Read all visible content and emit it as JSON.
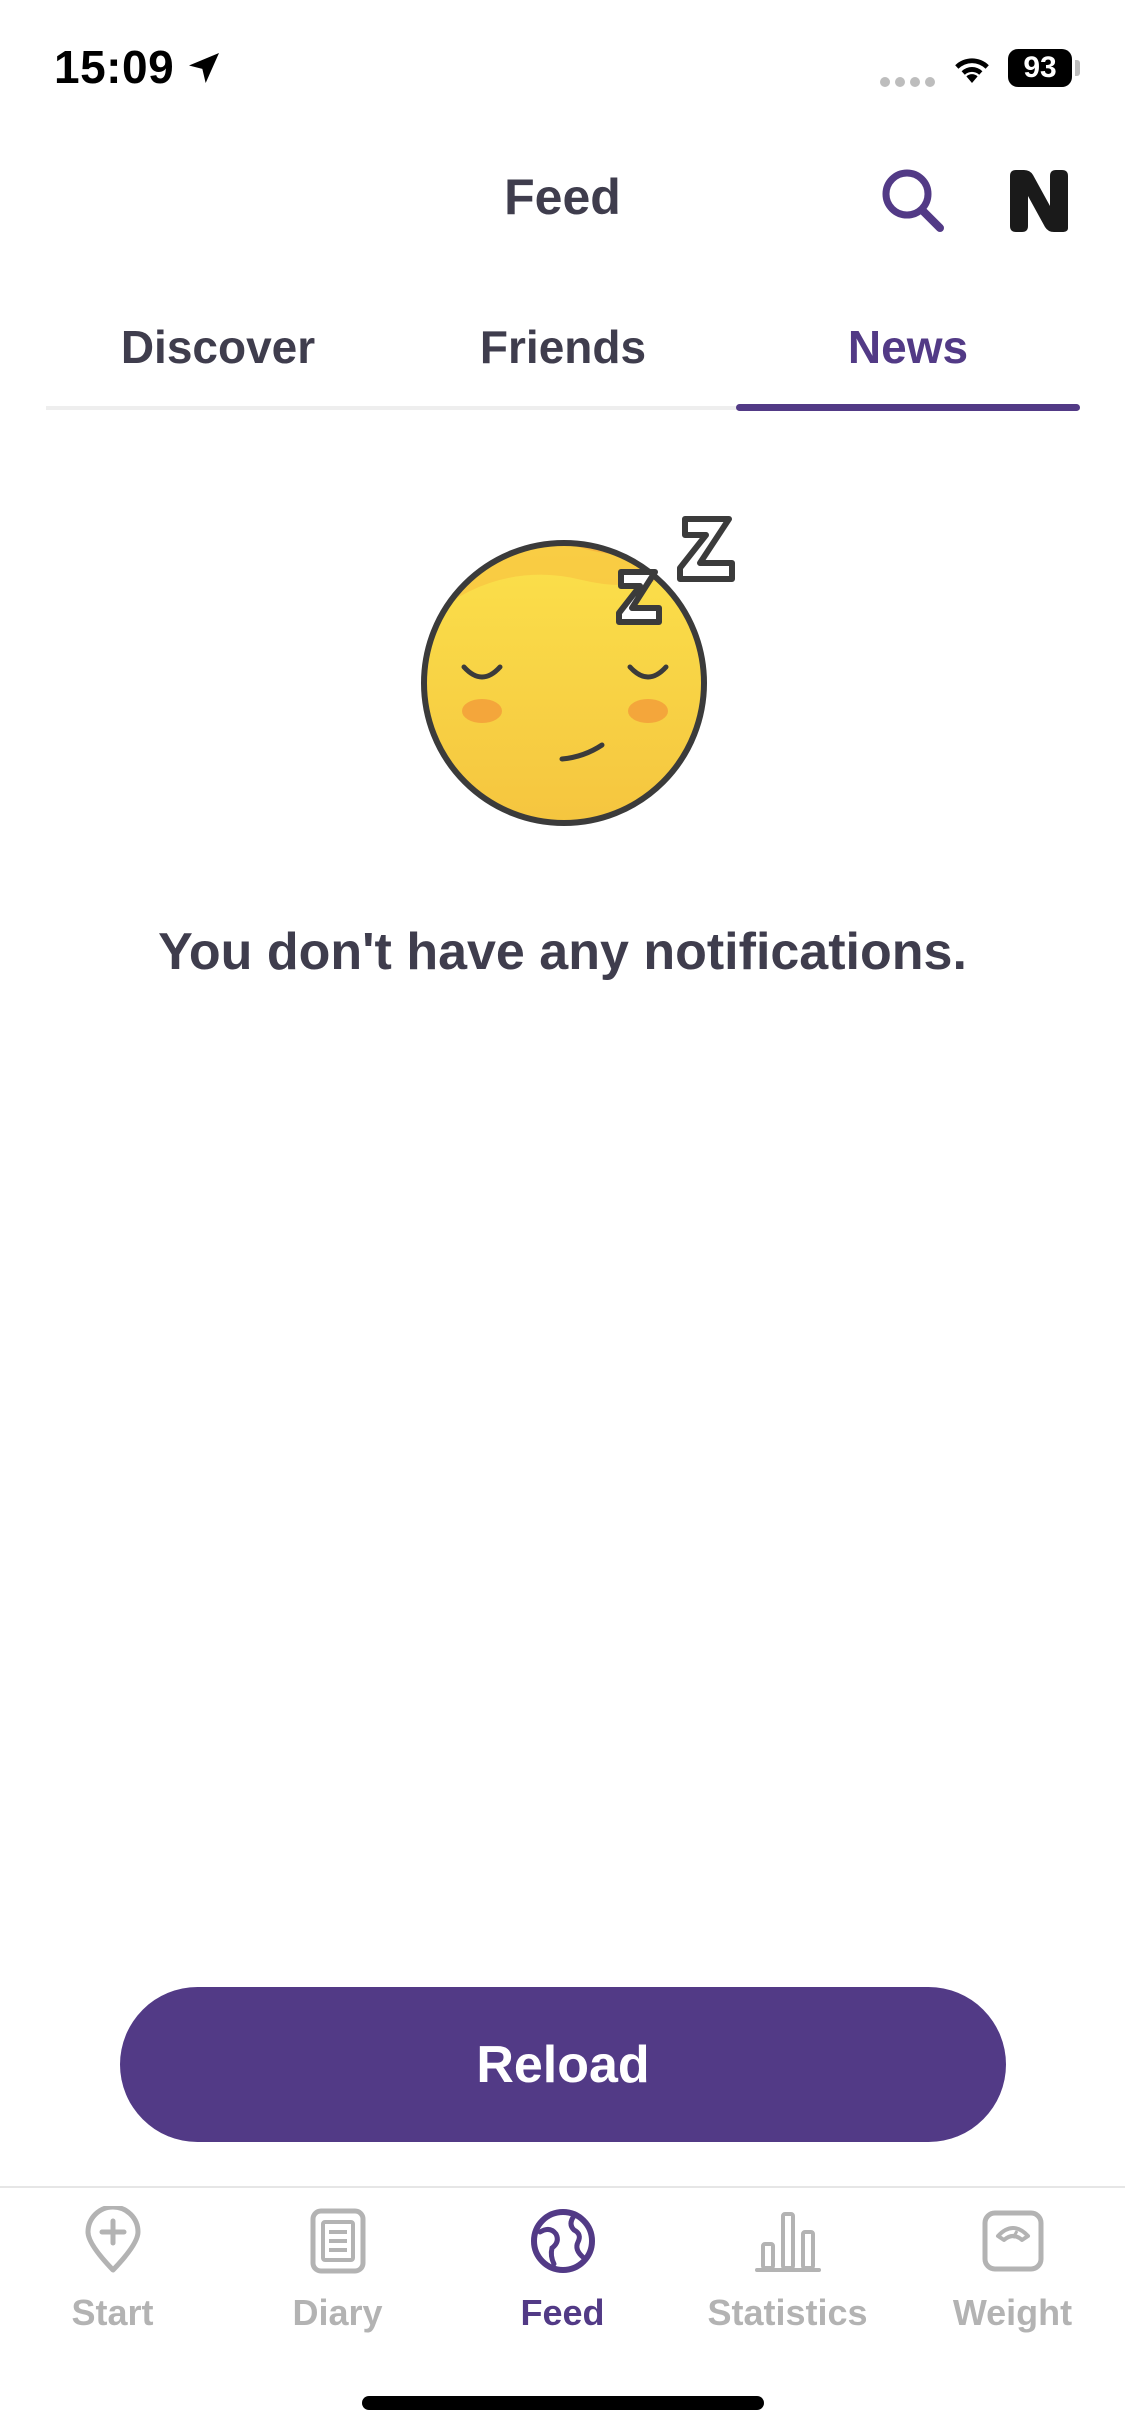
{
  "status_bar": {
    "time": "15:09",
    "battery": "93"
  },
  "header": {
    "title": "Feed",
    "search_icon": "search-icon",
    "logo_icon": "brand-logo-n"
  },
  "tabs": [
    {
      "label": "Discover",
      "active": false
    },
    {
      "label": "Friends",
      "active": false
    },
    {
      "label": "News",
      "active": true
    }
  ],
  "empty_state": {
    "icon": "sleeping-face-icon",
    "message": "You don't have any notifications."
  },
  "reload_button": {
    "label": "Reload"
  },
  "bottom_nav": [
    {
      "label": "Start",
      "icon": "map-pin-plus-icon",
      "active": false
    },
    {
      "label": "Diary",
      "icon": "diary-icon",
      "active": false
    },
    {
      "label": "Feed",
      "icon": "globe-icon",
      "active": true
    },
    {
      "label": "Statistics",
      "icon": "bar-chart-icon",
      "active": false
    },
    {
      "label": "Weight",
      "icon": "scale-icon",
      "active": false
    }
  ],
  "colors": {
    "accent": "#523a86",
    "text": "#3f3d4d",
    "inactive": "#b3b3b3"
  }
}
